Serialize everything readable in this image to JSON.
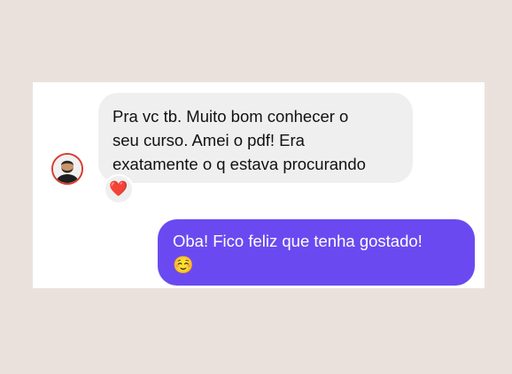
{
  "conversation": {
    "incoming": {
      "lines": [
        "Pra vc tb. Muito bom conhecer o",
        "seu curso. Amei o pdf! Era",
        "exatamente o q estava procurando"
      ],
      "reaction": "❤️"
    },
    "outgoing": {
      "line1": "Oba! Fico feliz que tenha gostado!",
      "emoji": "☺️"
    }
  },
  "colors": {
    "page_background": "#ebe1dc",
    "panel_background": "#ffffff",
    "incoming_bubble": "#efefef",
    "outgoing_bubble": "#6a4af0",
    "avatar_ring": "#d93a2f",
    "reaction_heart": "#e0245e"
  },
  "icons": {
    "avatar": "user-avatar-icon",
    "reaction": "heart-icon",
    "emoji": "smiling-face-icon"
  }
}
